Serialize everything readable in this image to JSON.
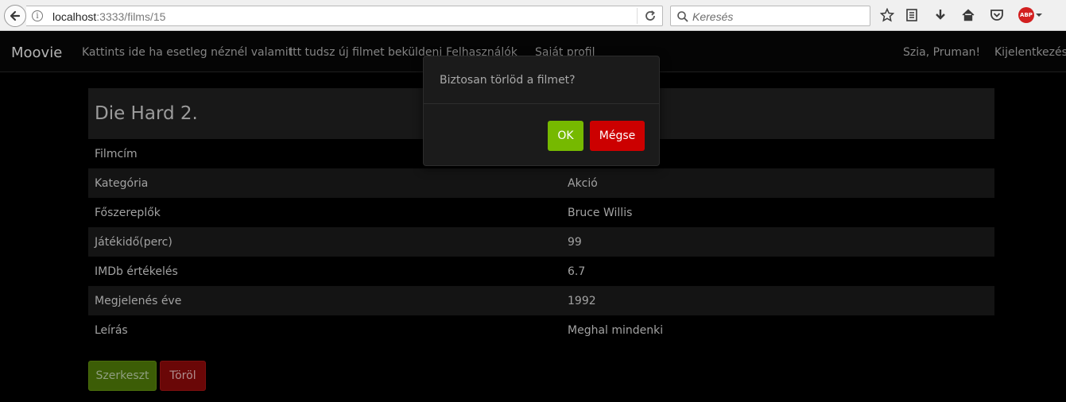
{
  "browser": {
    "url_host": "localhost",
    "url_path": ":3333/films/15",
    "search_placeholder": "Keresés",
    "abp_label": "ABP"
  },
  "nav": {
    "brand": "Moovie",
    "links": [
      "Kattints ide ha esetleg néznél valamit",
      "Itt tudsz új filmet beküldeni",
      "Felhasználók",
      "Saját profil"
    ],
    "greeting": "Szia, Pruman!",
    "logout": "Kijelentkezés"
  },
  "film": {
    "title": "Die Hard 2.",
    "rows": [
      {
        "label": "Filmcím",
        "value": ""
      },
      {
        "label": "Kategória",
        "value": "Akció"
      },
      {
        "label": "Főszereplők",
        "value": "Bruce Willis"
      },
      {
        "label": "Játékidő(perc)",
        "value": "99"
      },
      {
        "label": "IMDb értékelés",
        "value": "6.7"
      },
      {
        "label": "Megjelenés éve",
        "value": "1992"
      },
      {
        "label": "Leírás",
        "value": "Meghal mindenki"
      }
    ],
    "edit_label": "Szerkeszt",
    "delete_label": "Töröl"
  },
  "modal": {
    "message": "Biztosan törlöd a filmet?",
    "ok_label": "OK",
    "cancel_label": "Mégse"
  },
  "colors": {
    "ok": "#76b900",
    "cancel": "#cc0000",
    "edit": "#3c5d06",
    "delete": "#6a0707"
  }
}
